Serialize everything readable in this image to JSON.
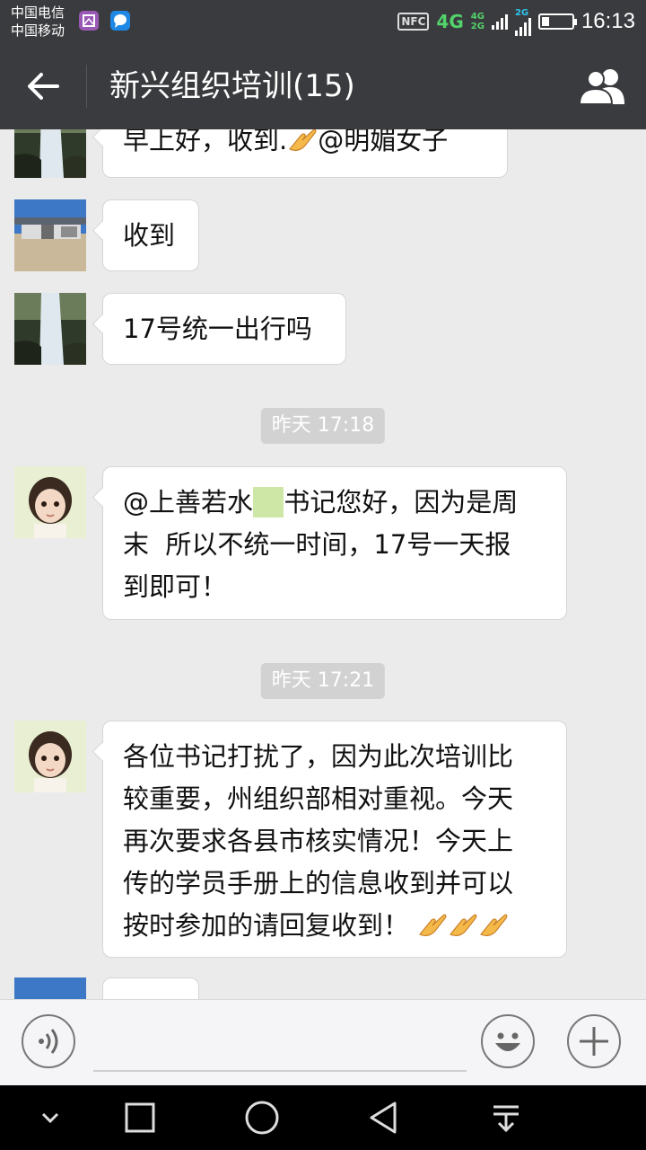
{
  "status_bar": {
    "carrier_1": "中国电信",
    "carrier_2": "中国移动",
    "nfc": "NFC",
    "network_4g": "4G",
    "network_small_top": "4G",
    "network_small_bottom": "2G",
    "network_2g": "2G",
    "time": "16:13"
  },
  "header": {
    "title": "新兴组织培训(15)",
    "back_icon": "arrow-left-icon",
    "members_icon": "group-members-icon"
  },
  "messages": [
    {
      "type": "text",
      "text": "早上好，收到.",
      "emoji": "clap",
      "mention": "@明媚女子",
      "avatar": "waterfall"
    },
    {
      "type": "text",
      "text": "收到",
      "avatar": "building"
    },
    {
      "type": "text",
      "text": "17号统一出行吗",
      "avatar": "waterfall"
    }
  ],
  "timestamp_1": "昨天 17:18",
  "message_4": {
    "line1_part1": "@上善若水",
    "line1_hidden": "xx",
    "line1_part2": "书记您好，因为是周",
    "line2": "末  所以不统一时间，17号一天报",
    "line3": "到即可！",
    "avatar": "child"
  },
  "timestamp_2": "昨天 17:21",
  "message_5": {
    "line1": "各位书记打扰了，因为此次培训比",
    "line2": "较重要，州组织部相对重视。今天",
    "line3": "再次要求各县市核实情况！今天上",
    "line4": "传的学员手册上的信息收到并可以",
    "line5": "按时参加的请回复收到！",
    "emoji_count": 3,
    "avatar": "child"
  },
  "input_bar": {
    "voice_icon": "voice-icon",
    "emoji_icon": "smiley-icon",
    "plus_icon": "plus-icon"
  },
  "nav_bar": [
    "chevron-down-icon",
    "square-icon",
    "circle-home-icon",
    "triangle-back-icon",
    "notification-pull-icon"
  ],
  "colors": {
    "header_bg": "#3a3b3e",
    "chat_bg": "#ebebeb",
    "bubble_bg": "#ffffff",
    "network_green": "#52d36b"
  }
}
